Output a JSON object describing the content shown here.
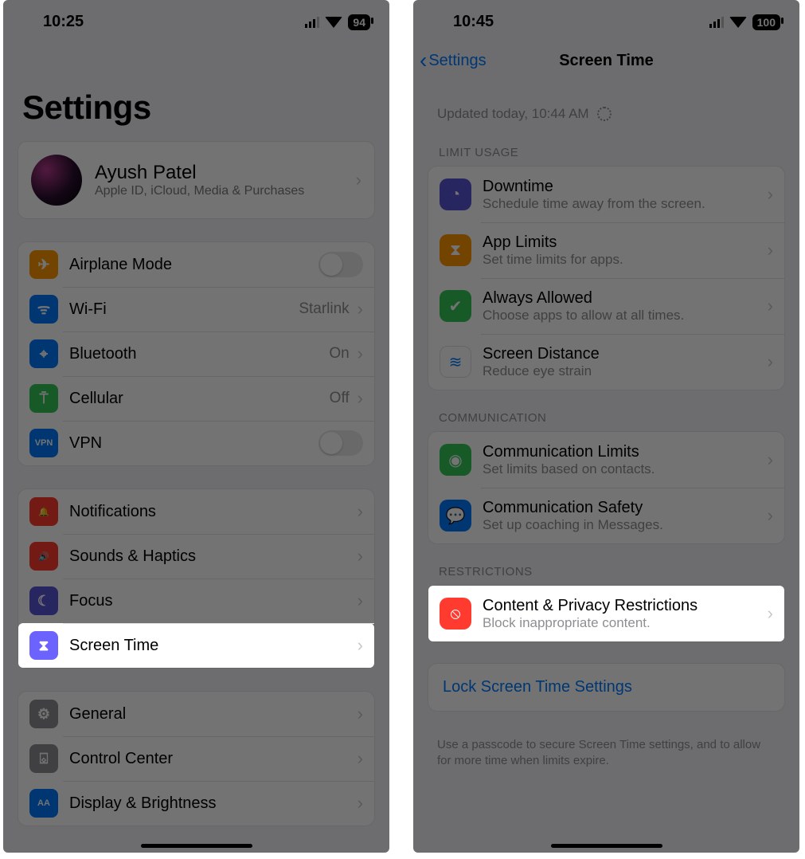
{
  "left": {
    "status_time": "10:25",
    "battery": "94",
    "page_title": "Settings",
    "profile": {
      "name": "Ayush Patel",
      "sub": "Apple ID, iCloud, Media & Purchases"
    },
    "group_net": [
      {
        "icon": "airplane-icon",
        "bg": "bg-orange",
        "glyph": "✈",
        "label": "Airplane Mode",
        "accessory": "toggle"
      },
      {
        "icon": "wifi-icon",
        "bg": "bg-blue",
        "glyph": "ᯤ",
        "label": "Wi-Fi",
        "value": "Starlink",
        "accessory": "chev"
      },
      {
        "icon": "bluetooth-icon",
        "bg": "bg-blue",
        "glyph": "⌖",
        "label": "Bluetooth",
        "value": "On",
        "accessory": "chev"
      },
      {
        "icon": "cellular-icon",
        "bg": "bg-green",
        "glyph": "⍑",
        "label": "Cellular",
        "value": "Off",
        "accessory": "chev"
      },
      {
        "icon": "vpn-icon",
        "bg": "bg-blue",
        "glyph": "VPN",
        "label": "VPN",
        "accessory": "toggle"
      }
    ],
    "group_alerts": [
      {
        "icon": "notifications-icon",
        "bg": "bg-red",
        "glyph": "🔔",
        "label": "Notifications",
        "accessory": "chev"
      },
      {
        "icon": "sounds-icon",
        "bg": "bg-red",
        "glyph": "🔊",
        "label": "Sounds & Haptics",
        "accessory": "chev"
      },
      {
        "icon": "focus-icon",
        "bg": "bg-indigo",
        "glyph": "☾",
        "label": "Focus",
        "accessory": "chev"
      },
      {
        "icon": "screentime-icon",
        "bg": "bg-purple",
        "glyph": "⧗",
        "label": "Screen Time",
        "accessory": "chev",
        "highlight": true
      }
    ],
    "group_general": [
      {
        "icon": "general-icon",
        "bg": "bg-grey",
        "glyph": "⚙",
        "label": "General",
        "accessory": "chev"
      },
      {
        "icon": "control-center-icon",
        "bg": "bg-grey",
        "glyph": "⌺",
        "label": "Control Center",
        "accessory": "chev"
      },
      {
        "icon": "display-icon",
        "bg": "bg-blue",
        "glyph": "AA",
        "label": "Display & Brightness",
        "accessory": "chev"
      }
    ]
  },
  "right": {
    "status_time": "10:45",
    "battery": "100",
    "back_label": "Settings",
    "nav_title": "Screen Time",
    "updated": "Updated today, 10:44 AM",
    "sections": {
      "limit_usage_header": "LIMIT USAGE",
      "limit_usage": [
        {
          "icon": "downtime-icon",
          "bg": "bg-indigo",
          "glyph": "◔",
          "title": "Downtime",
          "sub": "Schedule time away from the screen."
        },
        {
          "icon": "applimits-icon",
          "bg": "bg-orange",
          "glyph": "⧗",
          "title": "App Limits",
          "sub": "Set time limits for apps."
        },
        {
          "icon": "always-allowed-icon",
          "bg": "bg-green",
          "glyph": "✔",
          "title": "Always Allowed",
          "sub": "Choose apps to allow at all times."
        },
        {
          "icon": "screen-distance-icon",
          "bg": "bg-white",
          "glyph": "≋",
          "title": "Screen Distance",
          "sub": "Reduce eye strain"
        }
      ],
      "communication_header": "COMMUNICATION",
      "communication": [
        {
          "icon": "comm-limits-icon",
          "bg": "bg-green",
          "glyph": "◉",
          "title": "Communication Limits",
          "sub": "Set limits based on contacts."
        },
        {
          "icon": "comm-safety-icon",
          "bg": "bg-blue",
          "glyph": "💬",
          "title": "Communication Safety",
          "sub": "Set up coaching in Messages."
        }
      ],
      "restrictions_header": "RESTRICTIONS",
      "restrictions": [
        {
          "icon": "content-privacy-icon",
          "bg": "bg-red",
          "glyph": "⦸",
          "title": "Content & Privacy Restrictions",
          "sub": "Block inappropriate content.",
          "highlight": true
        }
      ],
      "lock_link": "Lock Screen Time Settings",
      "lock_footnote": "Use a passcode to secure Screen Time settings, and to allow for more time when limits expire."
    }
  }
}
